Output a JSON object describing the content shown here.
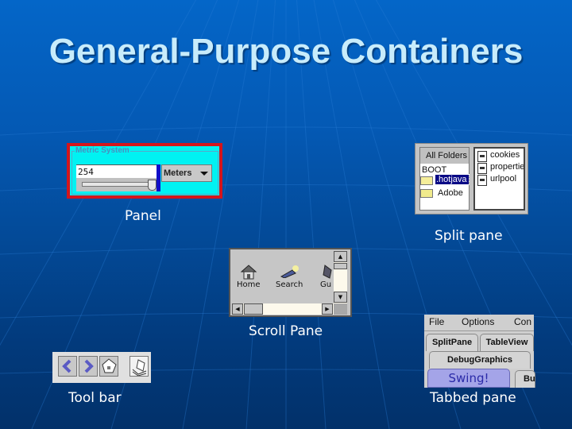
{
  "slide": {
    "title": "General-Purpose Containers",
    "colors": {
      "background_top": "#0466c8",
      "background_bottom": "#02316a",
      "title": "#c8ecfb",
      "caption": "#ffffff"
    }
  },
  "panel": {
    "caption": "Panel",
    "group_title": "Metric System",
    "input_value": "254",
    "unit_select": "Meters",
    "slider_value": 1.0,
    "colors": {
      "border": "#d4151c",
      "fill": "#00f2f2",
      "divider": "#1010c8"
    }
  },
  "split_pane": {
    "caption": "Split pane",
    "left": {
      "header": "All Folders",
      "items": [
        {
          "label": "BOOT",
          "icon": "none",
          "selected": false
        },
        {
          "label": ".hotjava",
          "icon": "folder-open-icon",
          "selected": true
        },
        {
          "label": "Adobe",
          "icon": "folder-icon",
          "selected": false
        }
      ]
    },
    "right": {
      "items": [
        {
          "label": "cookies",
          "icon": "file-icon"
        },
        {
          "label": "properties",
          "icon": "file-icon"
        },
        {
          "label": "urlpool",
          "icon": "file-icon"
        }
      ]
    }
  },
  "scroll_pane": {
    "caption": "Scroll Pane",
    "items": [
      {
        "label": "Home",
        "icon": "home-icon"
      },
      {
        "label": "Search",
        "icon": "search-flashlight-icon"
      },
      {
        "label": "Gu",
        "icon": "guide-icon"
      }
    ]
  },
  "toolbar": {
    "caption": "Tool bar",
    "buttons": [
      {
        "icon": "back-arrow-icon"
      },
      {
        "icon": "forward-arrow-icon"
      },
      {
        "icon": "home-icon"
      },
      {
        "icon": "print-icon"
      }
    ]
  },
  "tabbed_pane": {
    "caption": "Tabbed pane",
    "menu": [
      "File",
      "Options",
      "Con"
    ],
    "tab_rows": [
      [
        "SplitPane",
        "TableView"
      ],
      [
        "DebugGraphics"
      ],
      [
        "Swing!",
        "Bu"
      ]
    ],
    "selected_tab": "Swing!"
  }
}
